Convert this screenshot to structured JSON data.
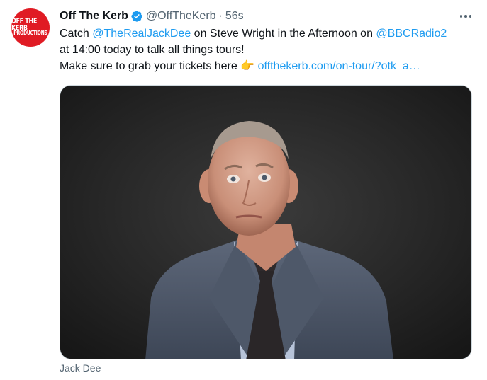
{
  "tweet": {
    "avatar": {
      "line1": "OFF THE KERB",
      "line2": "PRODUCTIONS",
      "bg_color": "#e01b24"
    },
    "display_name": "Off The Kerb",
    "verified_icon": "verified-badge-icon",
    "handle": "@OffTheKerb",
    "separator": "·",
    "time": "56s",
    "text": {
      "line1_prefix": "Catch ",
      "mention1": "@TheRealJackDee",
      "line1_middle": " on Steve Wright in the Afternoon on ",
      "mention2": "@BBCRadio2",
      "line2": "at 14:00 today to talk all things tours!",
      "line3_prefix": "Make sure to grab your tickets here ",
      "emoji": "👉",
      "url": "offthekerb.com/on-tour/?otk_a…"
    },
    "media": {
      "alt_subject": "Jack Dee"
    },
    "caption": "Jack Dee",
    "colors": {
      "link": "#1d9bf0",
      "secondary_text": "#536471",
      "verified": "#1d9bf0"
    }
  }
}
